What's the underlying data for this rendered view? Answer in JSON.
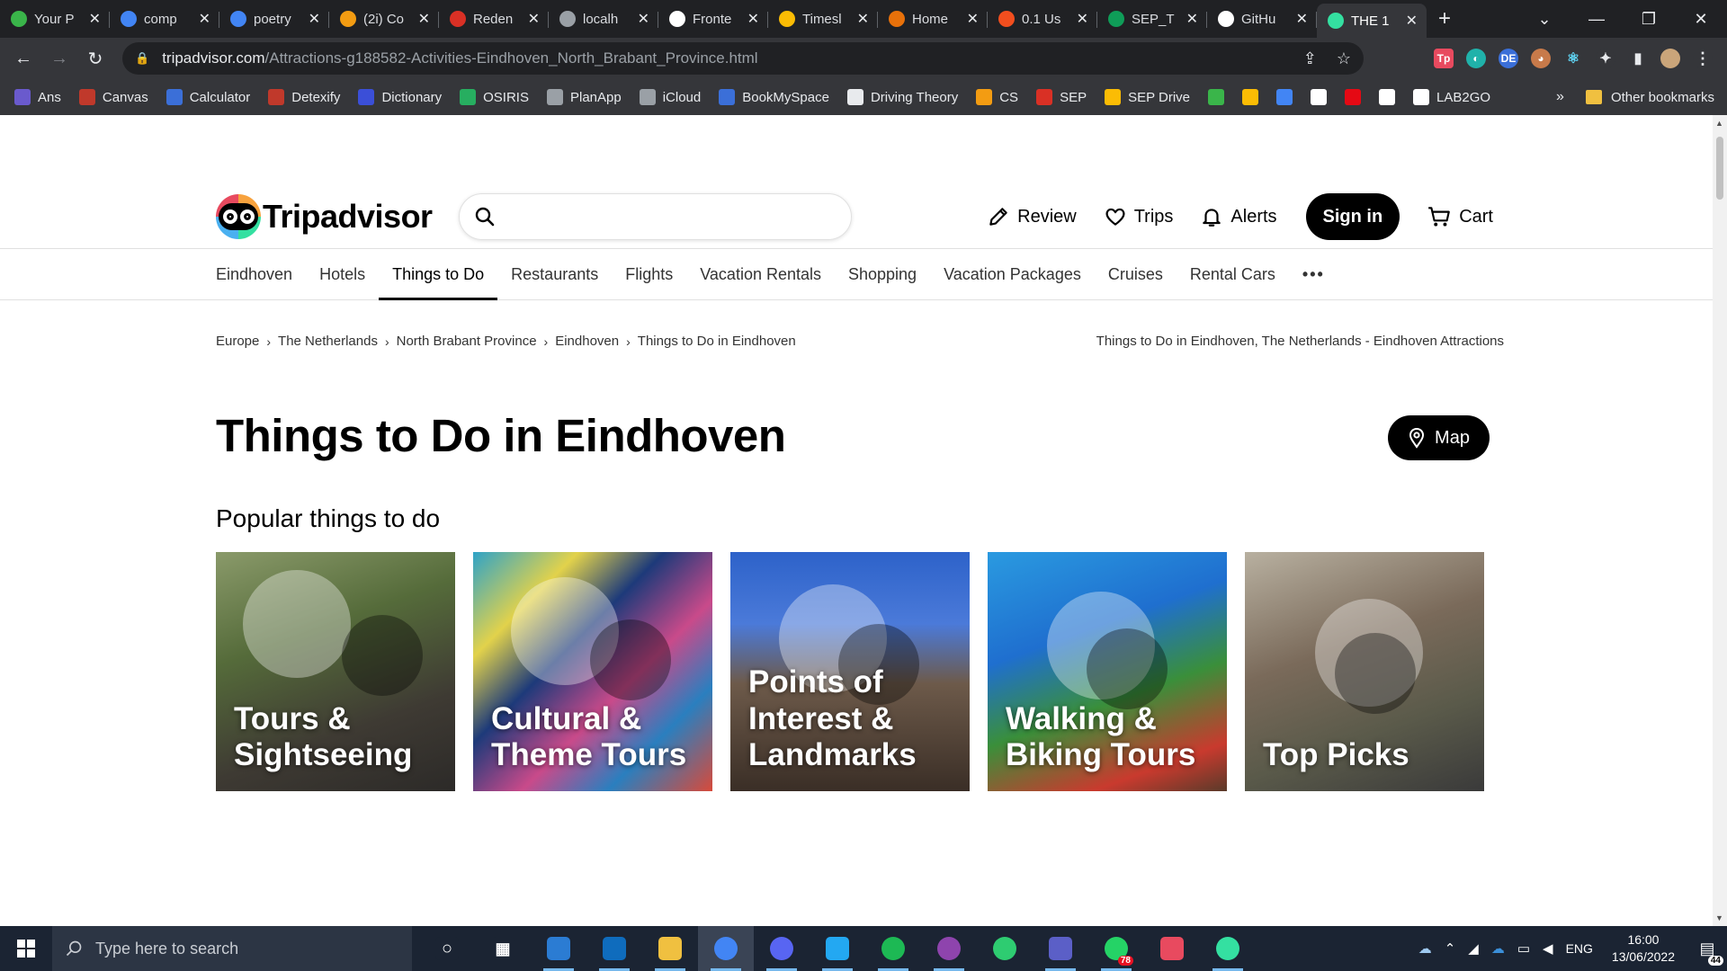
{
  "browser": {
    "tabs": [
      {
        "title": "Your P",
        "icon": "leaf-icon",
        "color": "#3ab54a",
        "active": false
      },
      {
        "title": "comp",
        "icon": "google-icon",
        "color": "#4285f4",
        "active": false
      },
      {
        "title": "poetry",
        "icon": "google-icon",
        "color": "#4285f4",
        "active": false
      },
      {
        "title": "(2i) Co",
        "icon": "flower-icon",
        "color": "#f39c12",
        "active": false
      },
      {
        "title": "Reden",
        "icon": "doc-icon",
        "color": "#d93025",
        "active": false
      },
      {
        "title": "localh",
        "icon": "globe-icon",
        "color": "#9aa0a6",
        "active": false
      },
      {
        "title": "Fronte",
        "icon": "github-icon",
        "color": "#ffffff",
        "active": false
      },
      {
        "title": "Timesl",
        "icon": "drive-icon",
        "color": "#fbbc04",
        "active": false
      },
      {
        "title": "Home",
        "icon": "ring-icon",
        "color": "#e8710a",
        "active": false
      },
      {
        "title": "0.1 Us",
        "icon": "figma-icon",
        "color": "#f24e1e",
        "active": false
      },
      {
        "title": "SEP_T",
        "icon": "sheets-icon",
        "color": "#0f9d58",
        "active": false
      },
      {
        "title": "GitHu",
        "icon": "github-icon",
        "color": "#ffffff",
        "active": false
      },
      {
        "title": "THE 1",
        "icon": "tripadvisor-icon",
        "color": "#34e0a1",
        "active": true
      }
    ],
    "url_domain": "tripadvisor.com",
    "url_path": "/Attractions-g188582-Activities-Eindhoven_North_Brabant_Province.html",
    "bookmarks": [
      {
        "label": "Ans",
        "icon": "ans-icon",
        "color": "#6a5acd"
      },
      {
        "label": "Canvas",
        "icon": "canvas-icon",
        "color": "#c0392b"
      },
      {
        "label": "Calculator",
        "icon": "calculator-icon",
        "color": "#3b6fd8"
      },
      {
        "label": "Detexify",
        "icon": "detexify-icon",
        "color": "#c0392b"
      },
      {
        "label": "Dictionary",
        "icon": "dictionary-icon",
        "color": "#3b4fd8"
      },
      {
        "label": "OSIRIS",
        "icon": "osiris-icon",
        "color": "#27ae60"
      },
      {
        "label": "PlanApp",
        "icon": "globe-icon",
        "color": "#9aa0a6"
      },
      {
        "label": "iCloud",
        "icon": "apple-icon",
        "color": "#9aa0a6"
      },
      {
        "label": "BookMySpace",
        "icon": "bookmyspace-icon",
        "color": "#3b6fd8"
      },
      {
        "label": "Driving Theory",
        "icon": "page-icon",
        "color": "#e8eaed"
      },
      {
        "label": "CS",
        "icon": "flower-icon",
        "color": "#f39c12"
      },
      {
        "label": "SEP",
        "icon": "doc-icon",
        "color": "#d93025"
      },
      {
        "label": "SEP Drive",
        "icon": "drive-icon",
        "color": "#fbbc04"
      },
      {
        "label": "",
        "icon": "leaf-icon",
        "color": "#3ab54a"
      },
      {
        "label": "",
        "icon": "drive-icon",
        "color": "#fbbc04"
      },
      {
        "label": "",
        "icon": "m-icon",
        "color": "#4285f4"
      },
      {
        "label": "",
        "icon": "github-icon",
        "color": "#ffffff"
      },
      {
        "label": "",
        "icon": "netflix-icon",
        "color": "#e50914"
      },
      {
        "label": "",
        "icon": "circle-icon",
        "color": "#ffffff"
      },
      {
        "label": "LAB2GO",
        "icon": "z-icon",
        "color": "#ffffff"
      }
    ],
    "bookmarks_overflow": "»",
    "other_bookmarks": "Other bookmarks"
  },
  "site": {
    "logo_text": "Tripadvisor",
    "search_placeholder": "",
    "header_nav": {
      "review": "Review",
      "trips": "Trips",
      "alerts": "Alerts",
      "sign_in": "Sign in",
      "cart": "Cart"
    },
    "subnav": [
      "Eindhoven",
      "Hotels",
      "Things to Do",
      "Restaurants",
      "Flights",
      "Vacation Rentals",
      "Shopping",
      "Vacation Packages",
      "Cruises",
      "Rental Cars"
    ],
    "subnav_active": "Things to Do",
    "subnav_more": "•••",
    "breadcrumbs": [
      "Europe",
      "The Netherlands",
      "North Brabant Province",
      "Eindhoven",
      "Things to Do in Eindhoven"
    ],
    "breadcrumb_sep": "›",
    "page_subtitle": "Things to Do in Eindhoven, The Netherlands - Eindhoven Attractions",
    "page_title": "Things to Do in Eindhoven",
    "map_button": "Map",
    "section_title": "Popular things to do",
    "cards": [
      {
        "label": "Tours & Sightseeing"
      },
      {
        "label": "Cultural & Theme Tours"
      },
      {
        "label": "Points of Interest & Landmarks"
      },
      {
        "label": "Walking & Biking Tours"
      },
      {
        "label": "Top Picks"
      }
    ]
  },
  "taskbar": {
    "search_placeholder": "Type here to search",
    "apps": [
      {
        "icon": "task-view-icon",
        "color": "#1b2433"
      },
      {
        "icon": "widgets-icon",
        "color": "#1b2433"
      },
      {
        "icon": "calendar-icon",
        "color": "#2b7cd3"
      },
      {
        "icon": "outlook-icon",
        "color": "#0f6cbd"
      },
      {
        "icon": "file-explorer-icon",
        "color": "#f0c040"
      },
      {
        "icon": "chrome-icon",
        "color": "#4285f4"
      },
      {
        "icon": "discord-icon",
        "color": "#5865f2"
      },
      {
        "icon": "vscode-icon",
        "color": "#23a8f2"
      },
      {
        "icon": "spotify-icon",
        "color": "#1db954"
      },
      {
        "icon": "github-desktop-icon",
        "color": "#8e44ad"
      },
      {
        "icon": "loading-app-icon",
        "color": "#2ecc71"
      },
      {
        "icon": "teams-icon",
        "color": "#5b5fc7"
      },
      {
        "icon": "whatsapp-icon",
        "color": "#25d366"
      },
      {
        "icon": "snipping-icon",
        "color": "#e84a5f"
      },
      {
        "icon": "tripadvisor-icon",
        "color": "#34e0a1"
      }
    ],
    "whatsapp_badge": "78",
    "language": "ENG",
    "time": "16:00",
    "date": "13/06/2022",
    "notification_count": "44"
  }
}
